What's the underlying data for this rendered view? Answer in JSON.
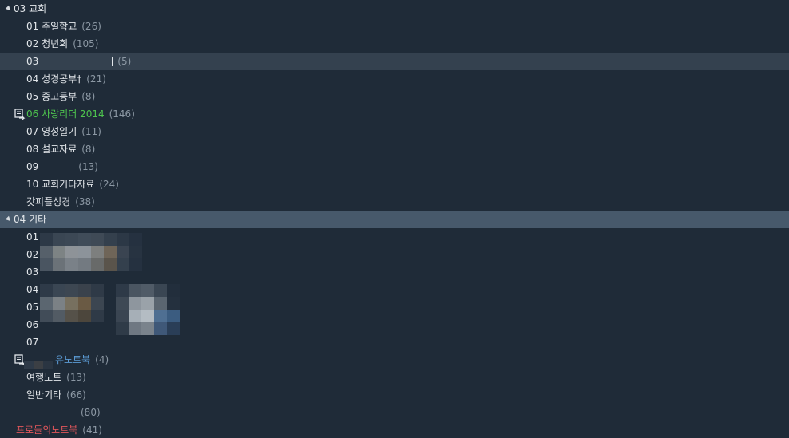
{
  "groups": [
    {
      "label": "03 교회",
      "items": [
        {
          "label": "01 주일학교",
          "count": "(26)"
        },
        {
          "label": "02 청년회",
          "count": "(105)"
        },
        {
          "label": "03",
          "count": "(5)",
          "selected": true
        },
        {
          "label": "04 성경공부†",
          "count": "(21)"
        },
        {
          "label": "05 중고등부",
          "count": "(8)"
        },
        {
          "label": "06 사랑리더 2014",
          "count": "(146)",
          "style": "green",
          "synced": true
        },
        {
          "label": "07 영성일기",
          "count": "(11)"
        },
        {
          "label": "08 설교자료",
          "count": "(8)"
        },
        {
          "label": "09",
          "count": "(13)"
        },
        {
          "label": "10 교회기타자료",
          "count": "(24)"
        },
        {
          "label": "갓피플성경",
          "count": "(38)"
        }
      ]
    },
    {
      "label": "04 기타",
      "selected": true,
      "items": [
        {
          "label": "01"
        },
        {
          "label": "02"
        },
        {
          "label": "03"
        },
        {
          "label": "04"
        },
        {
          "label": "05"
        },
        {
          "label": "06"
        },
        {
          "label": "07"
        },
        {
          "label": "유노트북",
          "count": "(4)",
          "style": "blue",
          "synced": true
        },
        {
          "label": "여행노트",
          "count": "(13)"
        },
        {
          "label": "일반기타",
          "count": "(66)"
        },
        {
          "label": "",
          "count": "(80)"
        }
      ]
    }
  ],
  "footer_item": {
    "label": "프로들의노트북",
    "count": "(41)",
    "style": "red"
  },
  "colors": {
    "background": "#1f2b38",
    "selected_row": "#34414f",
    "selected_group": "#47596b",
    "green": "#4ec44e",
    "blue": "#5b9bd5",
    "red": "#e0565b"
  },
  "icons": {
    "expand": "triangle-down-icon",
    "sync": "shared-notebook-sync-icon"
  }
}
